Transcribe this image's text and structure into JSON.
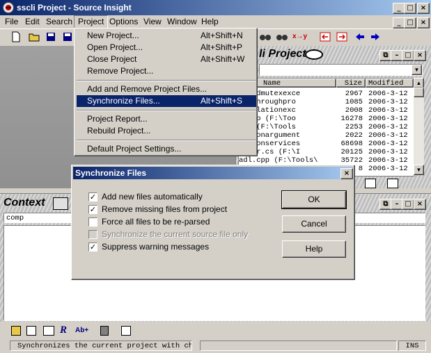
{
  "window": {
    "title": "sscli Project - Source Insight",
    "icon": "app-icon"
  },
  "menubar": [
    "File",
    "Edit",
    "Search",
    "Project",
    "Options",
    "View",
    "Window",
    "Help"
  ],
  "project_menu": {
    "groups": [
      [
        {
          "label": "New Project...",
          "shortcut": "Alt+Shift+N"
        },
        {
          "label": "Open Project...",
          "shortcut": "Alt+Shift+P"
        },
        {
          "label": "Close Project",
          "shortcut": "Alt+Shift+W"
        },
        {
          "label": "Remove Project...",
          "shortcut": ""
        }
      ],
      [
        {
          "label": "Add and Remove Project Files...",
          "shortcut": ""
        },
        {
          "label": "Synchronize Files...",
          "shortcut": "Alt+Shift+S"
        }
      ],
      [
        {
          "label": "Project Report...",
          "shortcut": ""
        },
        {
          "label": "Rebuild Project...",
          "shortcut": ""
        }
      ],
      [
        {
          "label": "Default Project Settings...",
          "shortcut": ""
        }
      ]
    ],
    "selected": "Synchronize Files..."
  },
  "project_panel": {
    "title": "li Project",
    "columns": [
      "Name",
      "Size",
      "Modified"
    ],
    "rows": [
      {
        "name": "lonedmutexexce",
        "size": "2967",
        "modified": "2006-3-12"
      },
      {
        "name": "sedthroughpro",
        "size": "1085",
        "modified": "2006-3-12"
      },
      {
        "name": "sviolationexc",
        "size": "2008",
        "modified": "2006-3-12"
      },
      {
        "name": "m.cpp (F:\\Too",
        "size": "16278",
        "modified": "2006-3-12"
      },
      {
        "name": "m.h (F:\\Tools",
        "size": "2253",
        "modified": "2006-3-12"
      },
      {
        "name": "rationargument",
        "size": "2022",
        "modified": "2006-3-12"
      },
      {
        "name": "rationservices",
        "size": "68698",
        "modified": "2006-3-12"
      },
      {
        "name": "rator.cs (F:\\I",
        "size": "20125",
        "modified": "2006-3-12"
      },
      {
        "name": "adl.cpp (F:\\Tools\\",
        "size": "35722",
        "modified": "2006-3-12"
      },
      {
        "name": "",
        "size": "8",
        "modified": "2006-3-12"
      }
    ]
  },
  "context_panel": {
    "title": "Context",
    "input_value": "comp"
  },
  "dialog": {
    "title": "Synchronize Files",
    "options": [
      {
        "label": "Add new files automatically",
        "checked": true,
        "enabled": true
      },
      {
        "label": "Remove missing files from project",
        "checked": true,
        "enabled": true
      },
      {
        "label": "Force all files to be re-parsed",
        "checked": false,
        "enabled": true
      },
      {
        "label": "Synchronize the current source file only",
        "checked": false,
        "enabled": false
      },
      {
        "label": "Suppress warning messages",
        "checked": true,
        "enabled": true
      }
    ],
    "buttons": {
      "ok": "OK",
      "cancel": "Cancel",
      "help": "Help"
    }
  },
  "statusbar": {
    "message": "Synchronizes the current project with char",
    "mode": "INS"
  },
  "colors": {
    "title_start": "#0a246a",
    "title_end": "#a6caf0",
    "selection": "#0a246a",
    "face": "#d4d0c8"
  }
}
